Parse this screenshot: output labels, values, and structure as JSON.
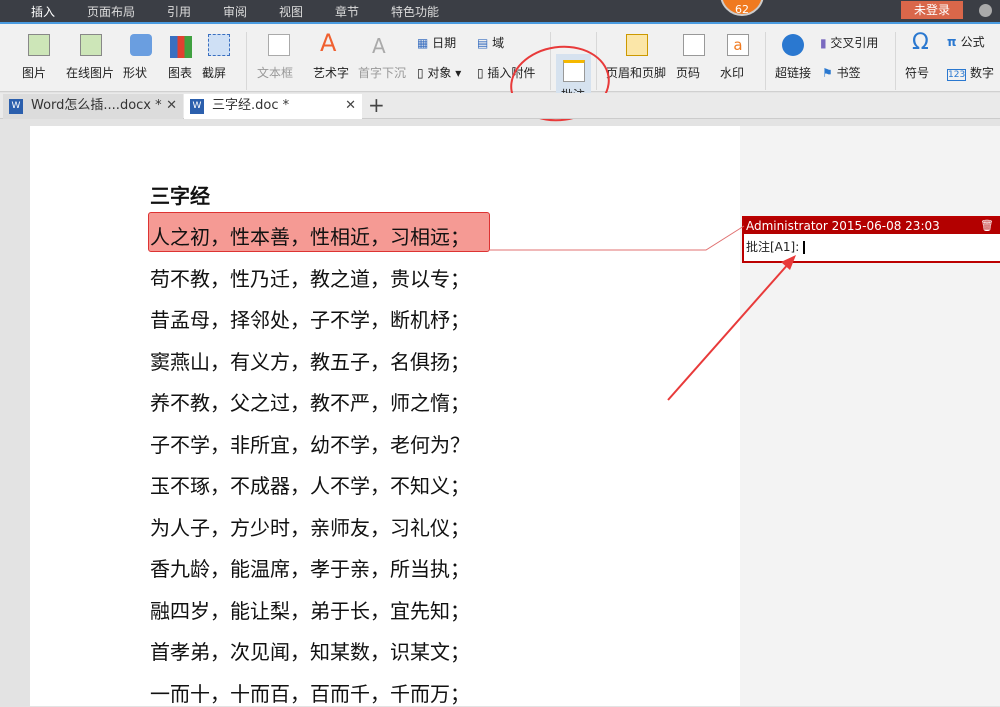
{
  "menubar": {
    "tabs": [
      "插入",
      "页面布局",
      "引用",
      "审阅",
      "视图",
      "章节",
      "特色功能"
    ],
    "badge": "62",
    "login": "未登录"
  },
  "ribbon": {
    "picture": "图片",
    "online_picture": "在线图片",
    "shape": "形状",
    "chart": "图表",
    "screenshot": "截屏",
    "textbox": "文本框",
    "wordart": "艺术字",
    "dropcap": "首字下沉",
    "date": "日期",
    "field": "域",
    "object": "对象",
    "attachment": "插入附件",
    "comment": "批注",
    "header_footer": "页眉和页脚",
    "page_number": "页码",
    "watermark": "水印",
    "hyperlink": "超链接",
    "cross_ref": "交叉引用",
    "bookmark": "书签",
    "symbol": "符号",
    "formula": "公式",
    "number": "数字"
  },
  "tabs": [
    {
      "label": "Word怎么插....docx *"
    },
    {
      "label": "三字经.doc *"
    }
  ],
  "tab_add": "+",
  "document": {
    "title": "三字经",
    "lines": [
      "人之初，性本善，性相近，习相远；",
      "苟不教，性乃迁，教之道，贵以专；",
      "昔孟母，择邻处，子不学，断机杼；",
      "窦燕山，有义方，教五子，名俱扬；",
      "养不教，父之过，教不严，师之惰；",
      "子不学，非所宜，幼不学，老何为？",
      "玉不琢，不成器，人不学，不知义；",
      "为人子，方少时，亲师友，习礼仪；",
      "香九龄，能温席，孝于亲，所当执；",
      "融四岁，能让梨，弟于长，宜先知；",
      "首孝弟，次见闻，知某数，识某文；",
      "一而十，十而百，百而千，千而万；"
    ]
  },
  "comment": {
    "header": "Administrator 2015-06-08 23:03",
    "body": "批注[A1]: "
  },
  "colors": {
    "highlight": "#f59a94",
    "comment_header": "#b30000",
    "annotation": "#e83a3a"
  }
}
